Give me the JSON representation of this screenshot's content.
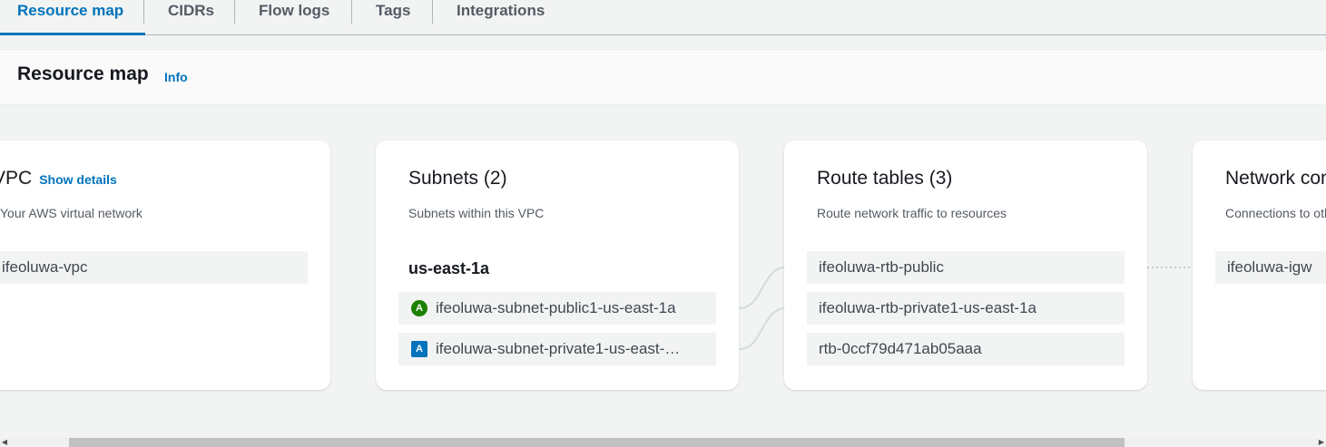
{
  "tabs": [
    {
      "label": "Resource map",
      "active": true
    },
    {
      "label": "CIDRs"
    },
    {
      "label": "Flow logs"
    },
    {
      "label": "Tags"
    },
    {
      "label": "Integrations"
    }
  ],
  "header": {
    "title": "Resource map",
    "info_label": "Info"
  },
  "vpc": {
    "title": "VPC",
    "show_details_label": "Show details",
    "description": "Your AWS virtual network",
    "item": "ifeoluwa-vpc"
  },
  "subnets": {
    "title": "Subnets (2)",
    "description": "Subnets within this VPC",
    "az": "us-east-1a",
    "items": [
      {
        "badge": "A",
        "type": "public",
        "label": "ifeoluwa-subnet-public1-us-east-1a"
      },
      {
        "badge": "A",
        "type": "private",
        "label": "ifeoluwa-subnet-private1-us-east-…"
      }
    ]
  },
  "route_tables": {
    "title": "Route tables (3)",
    "description": "Route network traffic to resources",
    "items": [
      {
        "label": "ifeoluwa-rtb-public"
      },
      {
        "label": "ifeoluwa-rtb-private1-us-east-1a"
      },
      {
        "label": "rtb-0ccf79d471ab05aaa"
      }
    ]
  },
  "network_connections": {
    "title": "Network connections",
    "description": "Connections to other networks",
    "item": "ifeoluwa-igw"
  },
  "colors": {
    "accent": "#0073bb",
    "public_badge": "#1d8102",
    "private_badge": "#0073bb",
    "connector": "#d5dbdb"
  }
}
